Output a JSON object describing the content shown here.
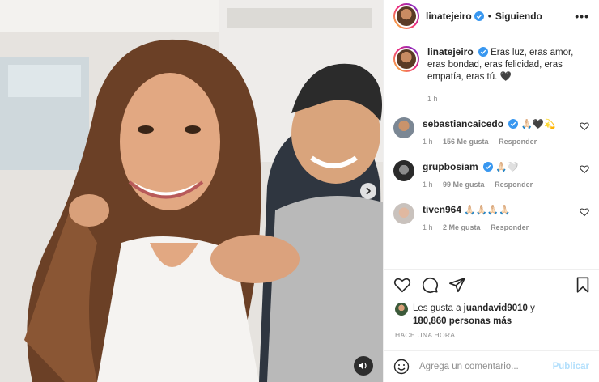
{
  "post": {
    "author": "linatejeiro",
    "follow_label": "Siguiendo",
    "separator": "•",
    "more_label": "•••"
  },
  "caption": {
    "user": "linatejeiro",
    "text": "Eras luz, eras amor, eras bondad, eras felicidad, eras empatía, eras tú. 🖤",
    "time": "1 h"
  },
  "comments": [
    {
      "user": "sebastiancaicedo",
      "text": "🙏🏻🖤💫",
      "time": "1 h",
      "likes": "156 Me gusta",
      "reply": "Responder"
    },
    {
      "user": "grupbosiam",
      "text": "🙏🏻🤍",
      "time": "1 h",
      "likes": "99 Me gusta",
      "reply": "Responder"
    },
    {
      "user": "tiven964",
      "text": "🙏🏻🙏🏻🙏🏻🙏🏻",
      "time": "1 h",
      "likes": "2 Me gusta",
      "reply": "Responder"
    }
  ],
  "likes": {
    "prefix": "Les gusta a ",
    "user": "juandavid9010",
    "middle": " y",
    "count": "180,860 personas más"
  },
  "posted_ago": "HACE UNA HORA",
  "comment_input": {
    "placeholder": "Agrega un comentario...",
    "value": ""
  },
  "publish_label": "Publicar",
  "colors": {
    "accent": "#0095f6",
    "publish_disabled": "#b2dffc",
    "verified": "#3897f0"
  }
}
